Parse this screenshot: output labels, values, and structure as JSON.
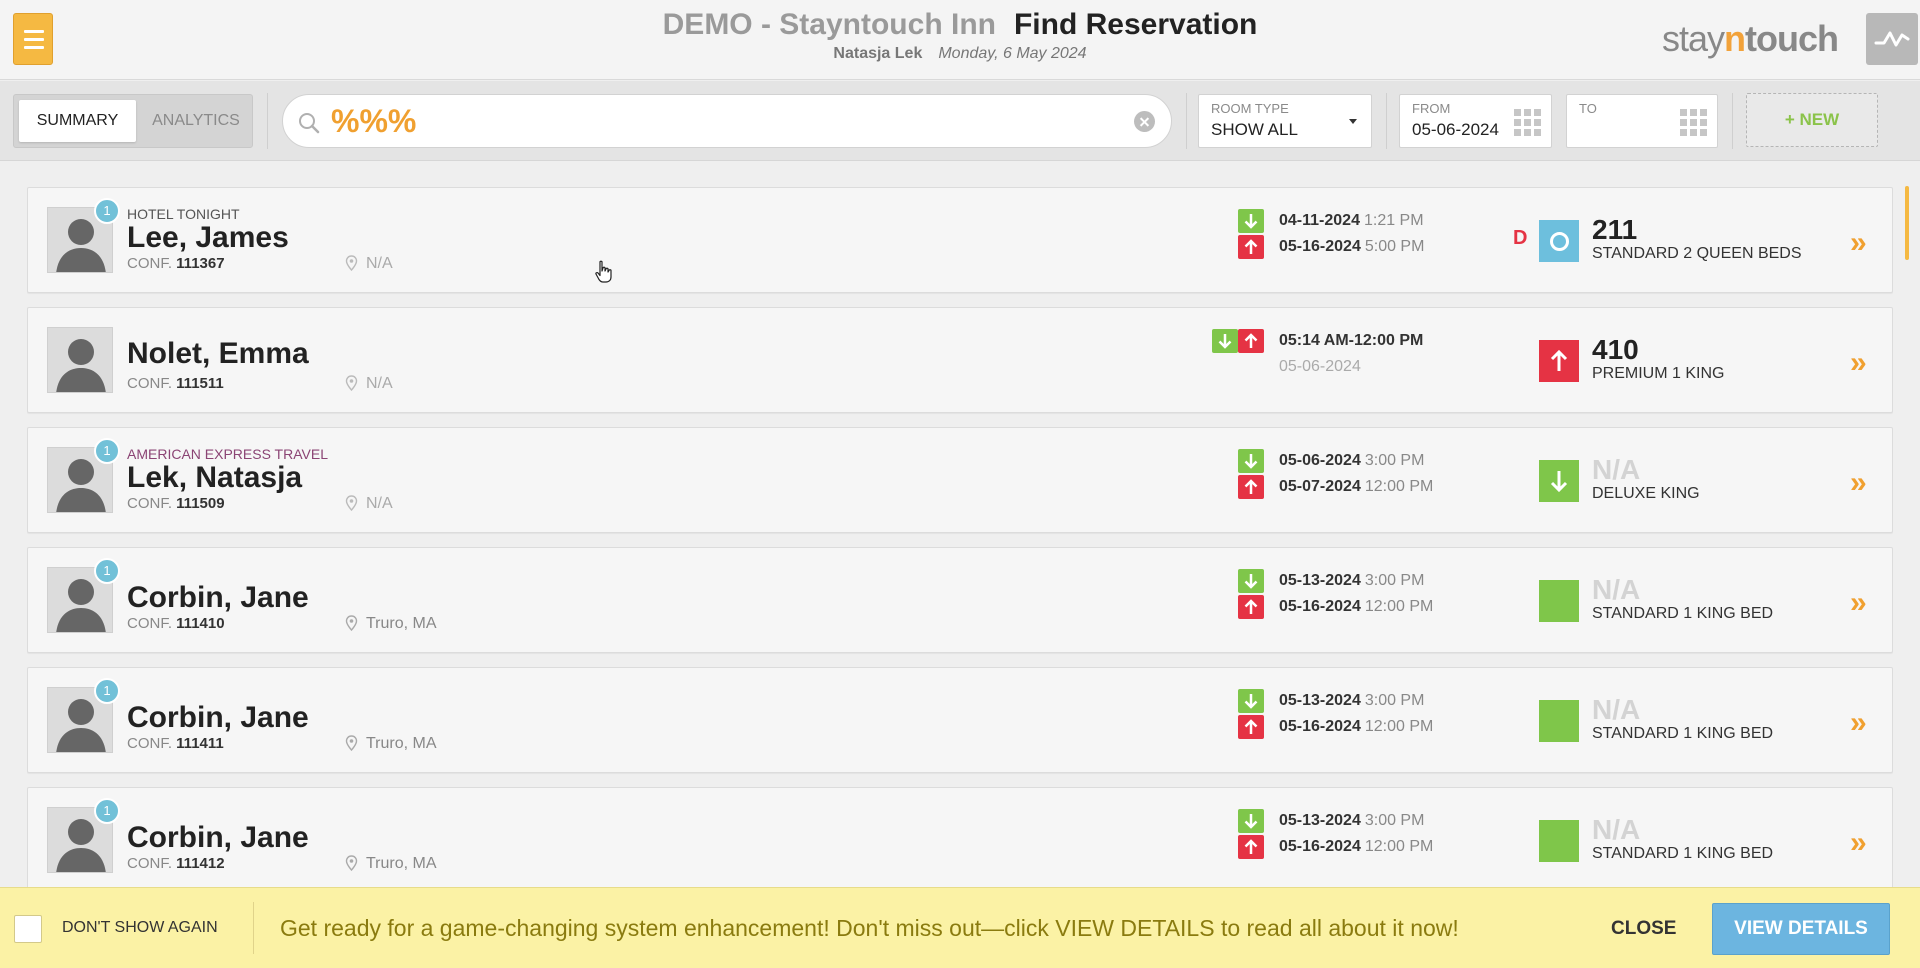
{
  "header": {
    "hotel_name": "DEMO - Stayntouch Inn",
    "page_title": "Find Reservation",
    "user_name": "Natasja Lek",
    "date": "Monday, 6 May 2024",
    "logo": {
      "stay": "stay",
      "n": "n",
      "touch": "touch"
    }
  },
  "toolbar": {
    "tabs": [
      {
        "label": "SUMMARY",
        "active": true
      },
      {
        "label": "ANALYTICS",
        "active": false
      }
    ],
    "search_value": "%%%",
    "room_type": {
      "label": "ROOM TYPE",
      "value": "SHOW ALL"
    },
    "from": {
      "label": "FROM",
      "value": "05-06-2024"
    },
    "to": {
      "label": "TO",
      "value": ""
    },
    "new_label": "+ NEW"
  },
  "reservations": [
    {
      "company": "HOTEL TONIGHT",
      "badge": "1",
      "name": "Lee, James",
      "conf_label": "CONF.",
      "conf": "111367",
      "location": "N/A",
      "arrival_date": "04-11-2024",
      "arrival_time": "1:21 PM",
      "departure_date": "05-16-2024",
      "departure_time": "5:00 PM",
      "flag": "D",
      "room_status": "blue",
      "room_number": "211",
      "room_type": "STANDARD 2 QUEEN BEDS"
    },
    {
      "company": "",
      "badge": "",
      "name": "Nolet, Emma",
      "conf_label": "CONF.",
      "conf": "111511",
      "location": "N/A",
      "time_range": "05:14 AM-12:00 PM",
      "date": "05-06-2024",
      "room_status": "red",
      "room_number": "410",
      "room_type": "PREMIUM 1 KING"
    },
    {
      "company": "AMERICAN EXPRESS TRAVEL",
      "badge": "1",
      "name": "Lek, Natasja",
      "conf_label": "CONF.",
      "conf": "111509",
      "location": "N/A",
      "arrival_date": "05-06-2024",
      "arrival_time": "3:00 PM",
      "departure_date": "05-07-2024",
      "departure_time": "12:00 PM",
      "room_status": "green-arrival",
      "room_number": "N/A",
      "room_type": "DELUXE KING"
    },
    {
      "company": "",
      "badge": "1",
      "name": "Corbin, Jane",
      "conf_label": "CONF.",
      "conf": "111410",
      "location": "Truro, MA",
      "arrival_date": "05-13-2024",
      "arrival_time": "3:00 PM",
      "departure_date": "05-16-2024",
      "departure_time": "12:00 PM",
      "room_status": "green",
      "room_number": "N/A",
      "room_type": "STANDARD 1 KING BED"
    },
    {
      "company": "",
      "badge": "1",
      "name": "Corbin, Jane",
      "conf_label": "CONF.",
      "conf": "111411",
      "location": "Truro, MA",
      "arrival_date": "05-13-2024",
      "arrival_time": "3:00 PM",
      "departure_date": "05-16-2024",
      "departure_time": "12:00 PM",
      "room_status": "green",
      "room_number": "N/A",
      "room_type": "STANDARD 1 KING BED"
    },
    {
      "company": "",
      "badge": "1",
      "name": "Corbin, Jane",
      "conf_label": "CONF.",
      "conf": "111412",
      "location": "Truro, MA",
      "arrival_date": "05-13-2024",
      "arrival_time": "3:00 PM",
      "departure_date": "05-16-2024",
      "departure_time": "12:00 PM",
      "room_status": "green",
      "room_number": "N/A",
      "room_type": "STANDARD 1 KING BED"
    }
  ],
  "banner": {
    "dont_show_label": "DON'T SHOW AGAIN",
    "message": "Get ready for a game-changing system enhancement! Don't miss out—click VIEW DETAILS to read all about it now!",
    "close_label": "CLOSE",
    "view_details_label": "VIEW DETAILS"
  },
  "colors": {
    "accent": "#f0a030",
    "arrival": "#7fc64a",
    "departure": "#e53344",
    "info": "#6cb5e0",
    "banner_bg": "#fbf2a5"
  },
  "icons": [
    "menu-icon",
    "pulse-icon",
    "search-icon",
    "clear-icon",
    "dropdown-caret-icon",
    "calendar-grid-icon",
    "avatar-silhouette-icon",
    "location-pin-icon",
    "arrival-arrow-icon",
    "departure-arrow-icon",
    "double-chevron-right-icon"
  ]
}
